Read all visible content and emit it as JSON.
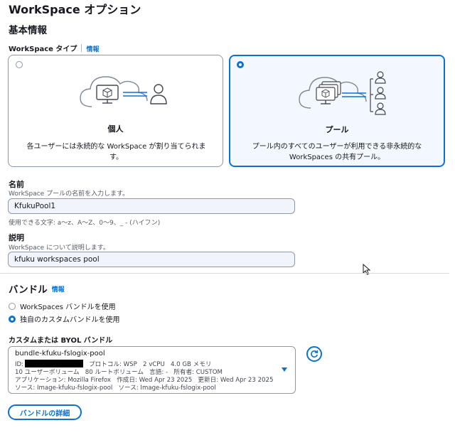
{
  "page": {
    "title": "WorkSpace オプション"
  },
  "basic": {
    "title": "基本情報",
    "type_label": "WorkSpace タイプ",
    "info_link": "情報",
    "cards": [
      {
        "title": "個人",
        "desc_line1": "各ユーザーには永続的な WorkSpace が割り当てられま",
        "desc_line2": "す。",
        "selected": false
      },
      {
        "title": "プール",
        "desc_line1": "プール内のすべてのユーザーが利用できる非永続的な",
        "desc_line2": "WorkSpaces の共有プール。",
        "selected": true
      }
    ],
    "name": {
      "label": "名前",
      "description": "WorkSpace プールの名前を入力します。",
      "value": "KfukuPool1",
      "constraint": "使用できる文字: a～z、A～Z、0～9、_ - (ハイフン)"
    },
    "description": {
      "label": "説明",
      "description": "WorkSpace について説明します。",
      "value": "kfuku workspaces pool"
    }
  },
  "bundle": {
    "title": "バンドル",
    "info_link": "情報",
    "options": [
      {
        "label": "WorkSpaces バンドルを使用",
        "selected": false
      },
      {
        "label": "独自のカスタムバンドルを使用",
        "selected": true
      }
    ],
    "custom_label": "カスタムまたは BYOL バンドル",
    "selected": {
      "name": "bundle-kfuku-fslogix-pool",
      "id_prefix": "ID:",
      "protocol": "プロトコル: WSP",
      "vcpu": "2 vCPU",
      "memory": "4.0 GB メモリ",
      "user_volume": "10 ユーザーボリューム",
      "root_volume": "80 ルートボリューム",
      "language": "言語: -",
      "owner": "所有者: CUSTOM",
      "application": "アプリケーション: Mozilla Firefox",
      "created": "作成日: Wed Apr 23 2025",
      "updated": "更新日: Wed Apr 23 2025",
      "source1": "ソース: Image-kfuku-fslogix-pool",
      "source2": "ソース: Image-kfuku-fslogix-pool"
    },
    "details_button": "バンドルの詳細"
  },
  "colors": {
    "accent": "#0972d3",
    "text": "#16191f",
    "muted": "#545b64",
    "border": "#8d99a8",
    "input_bg": "#f1f5fb"
  }
}
